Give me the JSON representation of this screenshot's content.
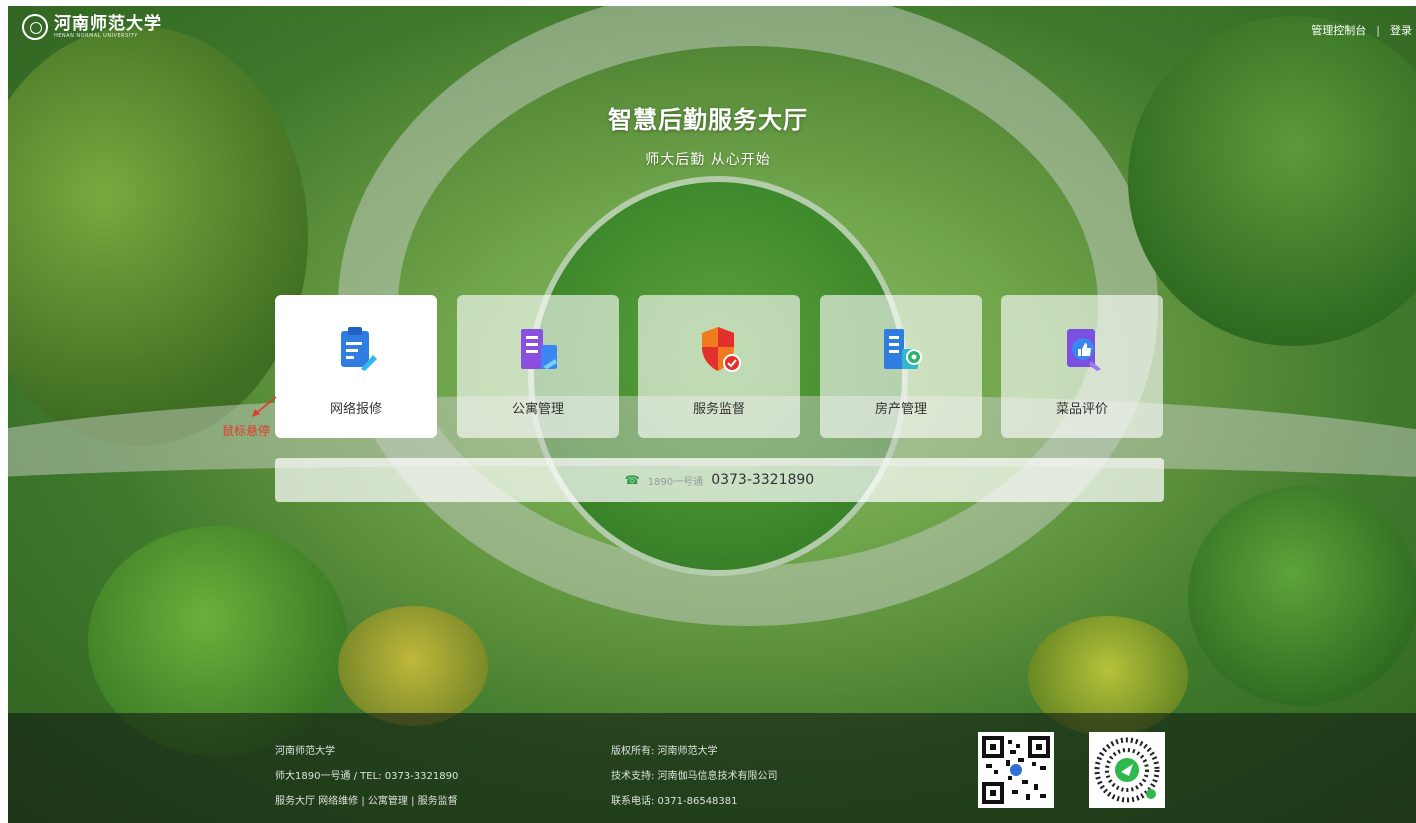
{
  "header": {
    "logo_text": "河南师范大学",
    "logo_en": "HENAN NORMAL UNIVERSITY",
    "nav": [
      "管理控制台",
      "|",
      "登录"
    ]
  },
  "hero": {
    "title": "智慧后勤服务大厅",
    "subtitle": "师大后勤  从心开始"
  },
  "services": [
    {
      "label": "网络报修",
      "icon": "clipboard-repair-icon"
    },
    {
      "label": "公寓管理",
      "icon": "apartment-building-icon"
    },
    {
      "label": "服务监督",
      "icon": "shield-check-icon"
    },
    {
      "label": "房产管理",
      "icon": "building-gear-icon"
    },
    {
      "label": "菜品评价",
      "icon": "thumbs-up-document-icon"
    }
  ],
  "phone": {
    "icon": "phone-icon",
    "label": "1890一号通",
    "number": "0373-3321890"
  },
  "annotation": "鼠标悬停",
  "footer": {
    "col1": [
      "河南师范大学",
      "师大1890一号通   /   TEL: 0373-3321890",
      "服务大厅   网络维修 | 公寓管理 | 服务监督"
    ],
    "col2": [
      "版权所有: 河南师范大学",
      "技术支持: 河南伽马信息技术有限公司",
      "联系电话: 0371-86548381"
    ],
    "qr": [
      "qrcode-icon",
      "mini-program-code-icon"
    ]
  },
  "colors": {
    "accent_green": "#2e9b4b",
    "annotation_red": "#e23b2e"
  }
}
